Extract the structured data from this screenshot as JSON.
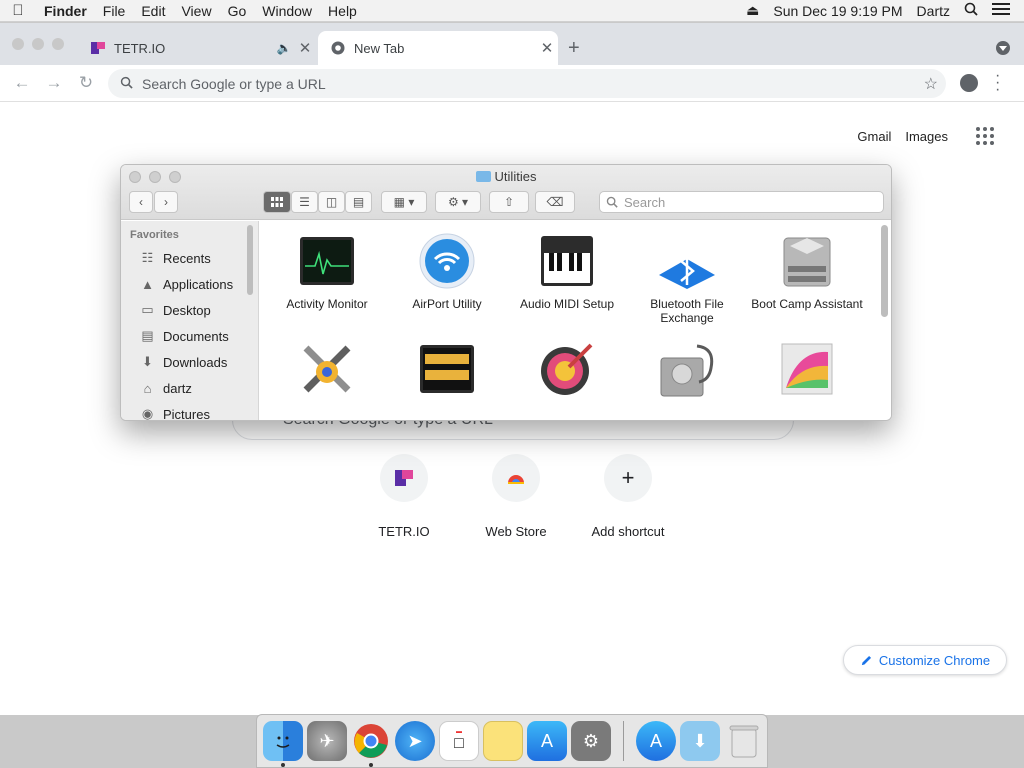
{
  "menubar": {
    "app": "Finder",
    "items": [
      "File",
      "Edit",
      "View",
      "Go",
      "Window",
      "Help"
    ],
    "datetime": "Sun Dec 19  9:19 PM",
    "user": "Dartz"
  },
  "chrome": {
    "tabs": [
      {
        "title": "TETR.IO"
      },
      {
        "title": "New Tab"
      }
    ],
    "omnibox_placeholder": "Search Google or type a URL",
    "top_links": {
      "gmail": "Gmail",
      "images": "Images"
    },
    "ntp_search_placeholder": "Search Google or type a URL",
    "shortcuts": [
      {
        "label": "TETR.IO"
      },
      {
        "label": "Web Store"
      },
      {
        "label": "Add shortcut"
      }
    ],
    "customize_label": "Customize Chrome"
  },
  "finder": {
    "title": "Utilities",
    "search_placeholder": "Search",
    "sidebar": {
      "header": "Favorites",
      "items": [
        {
          "label": "Recents",
          "icon": "clock-icon"
        },
        {
          "label": "Applications",
          "icon": "applications-icon"
        },
        {
          "label": "Desktop",
          "icon": "desktop-icon"
        },
        {
          "label": "Documents",
          "icon": "document-icon"
        },
        {
          "label": "Downloads",
          "icon": "download-icon"
        },
        {
          "label": "dartz",
          "icon": "home-icon"
        },
        {
          "label": "Pictures",
          "icon": "camera-icon"
        }
      ]
    },
    "items": [
      {
        "label": "Activity Monitor"
      },
      {
        "label": "AirPort Utility"
      },
      {
        "label": "Audio MIDI Setup"
      },
      {
        "label": "Bluetooth File Exchange"
      },
      {
        "label": "Boot Camp Assistant"
      }
    ],
    "second_row_icons": [
      "colorsync-icon",
      "console-icon",
      "digital-color-meter-icon",
      "disk-utility-icon",
      "grapher-icon"
    ]
  },
  "dock": {
    "apps": [
      "finder-icon",
      "launchpad-icon",
      "chrome-icon",
      "safari-icon",
      "calendar-icon",
      "notes-icon",
      "app-store-icon",
      "system-preferences-icon",
      "downloads-stack-icon",
      "trash-icon"
    ]
  },
  "colors": {
    "accent": "#1a73e8",
    "airport": "#2a8de0",
    "bluetooth": "#1f7ae0"
  }
}
